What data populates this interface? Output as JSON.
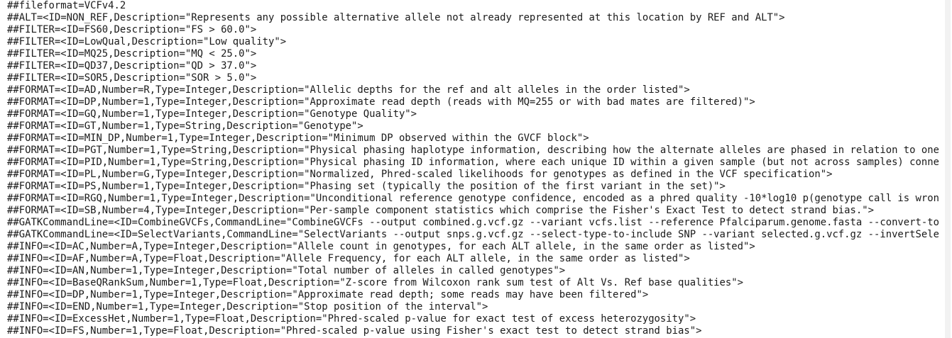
{
  "editor": {
    "lines": [
      "##fileformat=VCFv4.2",
      "##ALT=<ID=NON_REF,Description=\"Represents any possible alternative allele not already represented at this location by REF and ALT\">",
      "##FILTER=<ID=FS60,Description=\"FS > 60.0\">",
      "##FILTER=<ID=LowQual,Description=\"Low quality\">",
      "##FILTER=<ID=MQ25,Description=\"MQ < 25.0\">",
      "##FILTER=<ID=QD37,Description=\"QD > 37.0\">",
      "##FILTER=<ID=SOR5,Description=\"SOR > 5.0\">",
      "##FORMAT=<ID=AD,Number=R,Type=Integer,Description=\"Allelic depths for the ref and alt alleles in the order listed\">",
      "##FORMAT=<ID=DP,Number=1,Type=Integer,Description=\"Approximate read depth (reads with MQ=255 or with bad mates are filtered)\">",
      "##FORMAT=<ID=GQ,Number=1,Type=Integer,Description=\"Genotype Quality\">",
      "##FORMAT=<ID=GT,Number=1,Type=String,Description=\"Genotype\">",
      "##FORMAT=<ID=MIN_DP,Number=1,Type=Integer,Description=\"Minimum DP observed within the GVCF block\">",
      "##FORMAT=<ID=PGT,Number=1,Type=String,Description=\"Physical phasing haplotype information, describing how the alternate alleles are phased in relation to one anothe",
      "##FORMAT=<ID=PID,Number=1,Type=String,Description=\"Physical phasing ID information, where each unique ID within a given sample (but not across samples) connects rec",
      "##FORMAT=<ID=PL,Number=G,Type=Integer,Description=\"Normalized, Phred-scaled likelihoods for genotypes as defined in the VCF specification\">",
      "##FORMAT=<ID=PS,Number=1,Type=Integer,Description=\"Phasing set (typically the position of the first variant in the set)\">",
      "##FORMAT=<ID=RGQ,Number=1,Type=Integer,Description=\"Unconditional reference genotype confidence, encoded as a phred quality -10*log10 p(genotype call is wrong)\">",
      "##FORMAT=<ID=SB,Number=4,Type=Integer,Description=\"Per-sample component statistics which comprise the Fisher's Exact Test to detect strand bias.\">",
      "##GATKCommandLine=<ID=CombineGVCFs,CommandLine=\"CombineGVCFs --output combined.g.vcf.gz --variant vcfs.list --reference Pfalciparum.genome.fasta --convert-to-base-p",
      "##GATKCommandLine=<ID=SelectVariants,CommandLine=\"SelectVariants --output snps.g.vcf.gz --select-type-to-include SNP --variant selected.g.vcf.gz --invertSelect fals",
      "##INFO=<ID=AC,Number=A,Type=Integer,Description=\"Allele count in genotypes, for each ALT allele, in the same order as listed\">",
      "##INFO=<ID=AF,Number=A,Type=Float,Description=\"Allele Frequency, for each ALT allele, in the same order as listed\">",
      "##INFO=<ID=AN,Number=1,Type=Integer,Description=\"Total number of alleles in called genotypes\">",
      "##INFO=<ID=BaseQRankSum,Number=1,Type=Float,Description=\"Z-score from Wilcoxon rank sum test of Alt Vs. Ref base qualities\">",
      "##INFO=<ID=DP,Number=1,Type=Integer,Description=\"Approximate read depth; some reads may have been filtered\">",
      "##INFO=<ID=END,Number=1,Type=Integer,Description=\"Stop position of the interval\">",
      "##INFO=<ID=ExcessHet,Number=1,Type=Float,Description=\"Phred-scaled p-value for exact test of excess heterozygosity\">",
      "##INFO=<ID=FS,Number=1,Type=Float,Description=\"Phred-scaled p-value using Fisher's exact test to detect strand bias\">"
    ]
  }
}
